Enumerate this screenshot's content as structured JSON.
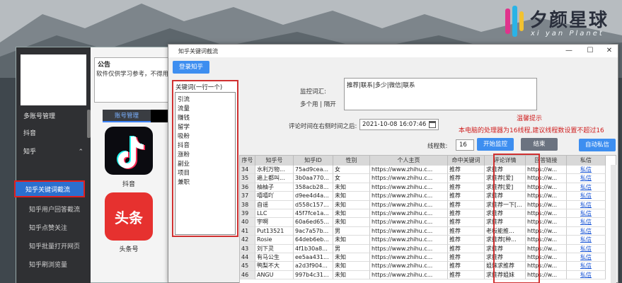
{
  "brand": {
    "name": "夕颜星球",
    "subtitle": "xi yan Planet"
  },
  "main_window": {
    "notice_title": "公告",
    "notice_text": "软件仅供学习参考，不得用",
    "sidebar": [
      {
        "label": "多账号管理"
      },
      {
        "label": "抖音"
      },
      {
        "label": "知乎",
        "arrow": "⌃"
      },
      {
        "label": "知乎关键词截流",
        "active": true
      },
      {
        "label": "知乎用户回答截流"
      },
      {
        "label": "知乎点赞关注"
      },
      {
        "label": "知乎批量打开网页"
      },
      {
        "label": "知乎刷浏览量"
      }
    ],
    "account_tab": "账号管理",
    "apps": [
      {
        "label": "抖音"
      },
      {
        "label": "头条号"
      }
    ],
    "toutiao_tile_text": "头条"
  },
  "dialog": {
    "title": "知乎关键词截流",
    "window_buttons": [
      "—",
      "☐",
      "✕"
    ],
    "login_button": "登录知乎",
    "keyword_title": "关键词(一行一个)",
    "keywords": [
      "引流",
      "流量",
      "赚钱",
      "留学",
      "吸粉",
      "抖音",
      "涨粉",
      "副业",
      "项目",
      "兼职"
    ],
    "monitor_label": "监控词汇:",
    "monitor_value": "推荐|联系|多少|微信|联系",
    "separator_hint": "多个用 | 隔开",
    "time_label": "评论时间在右侧时间之后:",
    "time_value": "2021-10-08 16:07:46",
    "hint_title": "温馨提示",
    "hint_text": "本电脑的处理器为16线程,建议线程数设置不超过16",
    "threads_label": "线程数:",
    "threads_value": "16",
    "start_button": "开始监控",
    "stop_button": "结束",
    "auto_msg_button": "自动私信",
    "table": {
      "headers": [
        "序号",
        "知乎号",
        "知乎ID",
        "性别",
        "个人主页",
        "命中关键词",
        "评论详情",
        "回答链接",
        "私信"
      ],
      "rows": [
        [
          "34",
          "水利万物...",
          "75ad9cea...",
          "女",
          "https://www.zhihu.c...",
          "推荐",
          "求推荐",
          "https://w...",
          "私信"
        ],
        [
          "35",
          "遍上都叫...",
          "3b0aa770...",
          "女",
          "https://www.zhihu.c...",
          "推荐",
          "求推荐[爱]",
          "https://w...",
          "私信"
        ],
        [
          "36",
          "柚柚子",
          "358acb28...",
          "未知",
          "https://www.zhihu.c...",
          "推荐",
          "求推荐[爱]",
          "https://w...",
          "私信"
        ],
        [
          "37",
          "嘻嘻吖",
          "d9ee4d4a...",
          "未知",
          "https://www.zhihu.c...",
          "推荐",
          "求推荐",
          "https://w...",
          "私信"
        ],
        [
          "38",
          "自谣",
          "d558c157...",
          "未知",
          "https://www.zhihu.c...",
          "推荐",
          "求推荐一下[...",
          "https://w...",
          "私信"
        ],
        [
          "39",
          "LLC",
          "45f7fce1a...",
          "未知",
          "https://www.zhihu.c...",
          "推荐",
          "求推荐",
          "https://w...",
          "私信"
        ],
        [
          "40",
          "宇啊",
          "60a6ed65...",
          "未知",
          "https://www.zhihu.c...",
          "推荐",
          "求推荐",
          "https://w...",
          "私信"
        ],
        [
          "41",
          "Put13521",
          "9ac7a57b...",
          "男",
          "https://www.zhihu.c...",
          "推荐",
          "老板能推...",
          "https://w...",
          "私信"
        ],
        [
          "42",
          "Rosie",
          "64deb6eb...",
          "未知",
          "https://www.zhihu.c...",
          "推荐",
          "求推荐[种...",
          "https://w...",
          "私信"
        ],
        [
          "43",
          "刘下灵",
          "4f1b30a8...",
          "男",
          "https://www.zhihu.c...",
          "推荐",
          "求推荐",
          "https://w...",
          "私信"
        ],
        [
          "44",
          "有马公生",
          "ee5aa431...",
          "未知",
          "https://www.zhihu.c...",
          "推荐",
          "求推荐",
          "https://w...",
          "私信"
        ],
        [
          "45",
          "鸭梨不大",
          "a2d3f904...",
          "未知",
          "https://www.zhihu.c...",
          "推荐",
          "姐妹求推荐",
          "https://w...",
          "私信"
        ],
        [
          "46",
          "ANGU",
          "997b4c31...",
          "未知",
          "https://www.zhihu.c...",
          "推荐",
          "求推荐姐妹",
          "https://w...",
          "私信"
        ]
      ]
    }
  },
  "colors": {
    "accent": "#3d8ef0",
    "warning": "#d02020",
    "frame": "#d03030"
  }
}
